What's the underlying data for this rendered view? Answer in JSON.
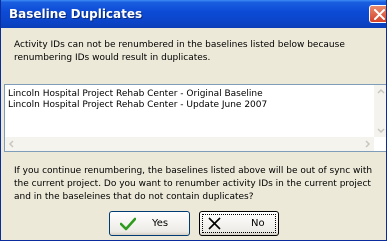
{
  "dialog": {
    "title": "Baseline Duplicates",
    "message": "Activity IDs can not be renumbered in the baselines listed below because renumbering IDs would result in duplicates.",
    "baselines": [
      "Lincoln Hospital Project Rehab Center - Original Baseline",
      "Lincoln Hospital Project Rehab Center - Update June 2007"
    ],
    "question": "If you continue renumbering, the baselines listed above will be out of sync with the current project. Do you want to renumber activity IDs in the current project and in the baseleines that do not contain duplicates?",
    "yes_label": "Yes",
    "no_label": "No"
  },
  "icons": {
    "close": "close-icon",
    "yes": "checkmark-icon",
    "no": "x-icon"
  },
  "colors": {
    "titlebar": "#0b46cc",
    "close_button": "#d4432a",
    "dialog_background": "#ece9d8",
    "checkmark": "#2e9a1e"
  }
}
